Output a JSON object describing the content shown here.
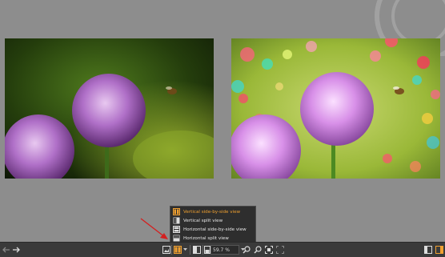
{
  "view_menu": {
    "items": [
      {
        "label": "Vertical side-by-side view",
        "selected": true
      },
      {
        "label": "Vertical split view",
        "selected": false
      },
      {
        "label": "Horizontal side-by-side view",
        "selected": false
      },
      {
        "label": "Horizontal split view",
        "selected": false
      }
    ]
  },
  "toolbar": {
    "zoom_value": "59.7 %"
  },
  "colors": {
    "accent": "#f0a030",
    "annotation_arrow": "#d42020"
  },
  "icons": [
    "back-arrow-icon",
    "forward-arrow-icon",
    "single-view-icon",
    "compare-view-icon",
    "chevron-down-icon",
    "preview-icon",
    "frame-icon",
    "zoom-in-icon",
    "zoom-out-icon",
    "fit-icon",
    "actual-size-icon",
    "panel-icon"
  ]
}
